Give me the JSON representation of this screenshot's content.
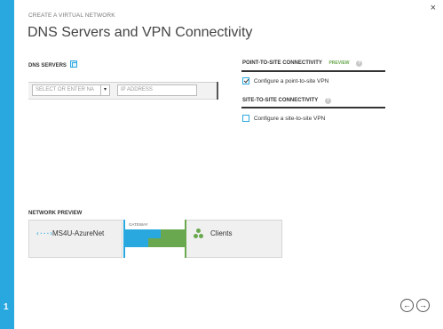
{
  "step": {
    "number": "1"
  },
  "header": {
    "close_glyph": "×",
    "subtitle": "CREATE A VIRTUAL NETWORK",
    "title": "DNS Servers and VPN Connectivity"
  },
  "dns": {
    "label": "DNS SERVERS",
    "select_placeholder": "SELECT OR ENTER NA",
    "select_caret": "▾",
    "ip_placeholder": "IP ADDRESS"
  },
  "point_to_site": {
    "label": "POINT-TO-SITE CONNECTIVITY",
    "preview_tag": "PREVIEW",
    "help_glyph": "?",
    "checkbox_label": "Configure a point-to-site VPN",
    "checked": true
  },
  "site_to_site": {
    "label": "SITE-TO-SITE CONNECTIVITY",
    "help_glyph": "?",
    "checkbox_label": "Configure a site-to-site VPN",
    "checked": false
  },
  "network_preview": {
    "label": "NETWORK PREVIEW",
    "vnet_icon": "‹···›",
    "vnet_name": "MS4U-AzureNet",
    "gateway_label": "GATEWAY",
    "clients_name": "Clients"
  },
  "nav": {
    "back_glyph": "←",
    "next_glyph": "→"
  },
  "colors": {
    "accent_blue": "#29a8e0",
    "accent_green": "#6aa84f"
  }
}
